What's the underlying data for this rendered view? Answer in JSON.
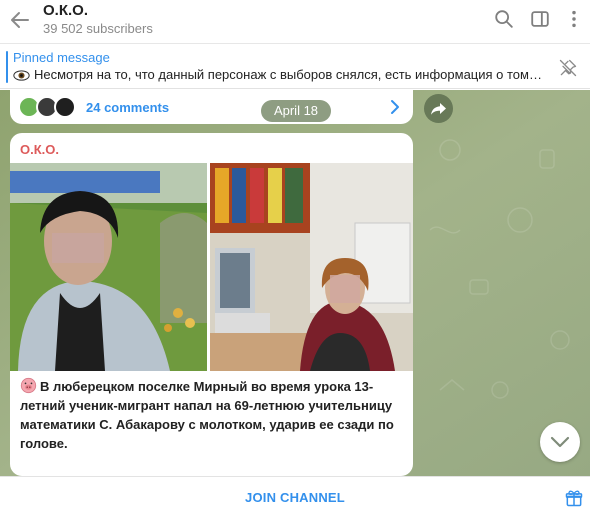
{
  "header": {
    "title": "О.К.О.",
    "subscribers": "39 502 subscribers",
    "icons": [
      "back-arrow-icon",
      "search-icon",
      "sidebar-toggle-icon",
      "more-vertical-icon"
    ]
  },
  "pinned": {
    "title": "Pinned message",
    "text": "Несмотря на то, что данный персонаж с выборов снялся, есть информация о том, что...",
    "icon": "eye-icon"
  },
  "prev_message": {
    "comments_label": "24 comments"
  },
  "date_badge": "April 18",
  "post": {
    "author": "О.К.О.",
    "text": "В люберецком поселке Мирный во время урока 13-летний ученик-мигрант напал на 69-летнюю учительницу математики С. Абакарову с молотком,  ударив ее сзади по голове."
  },
  "footer": {
    "join_label": "JOIN CHANNEL"
  },
  "colors": {
    "accent": "#3390ec",
    "author": "#dd5a5a",
    "chat_bg": "#90a07a"
  }
}
